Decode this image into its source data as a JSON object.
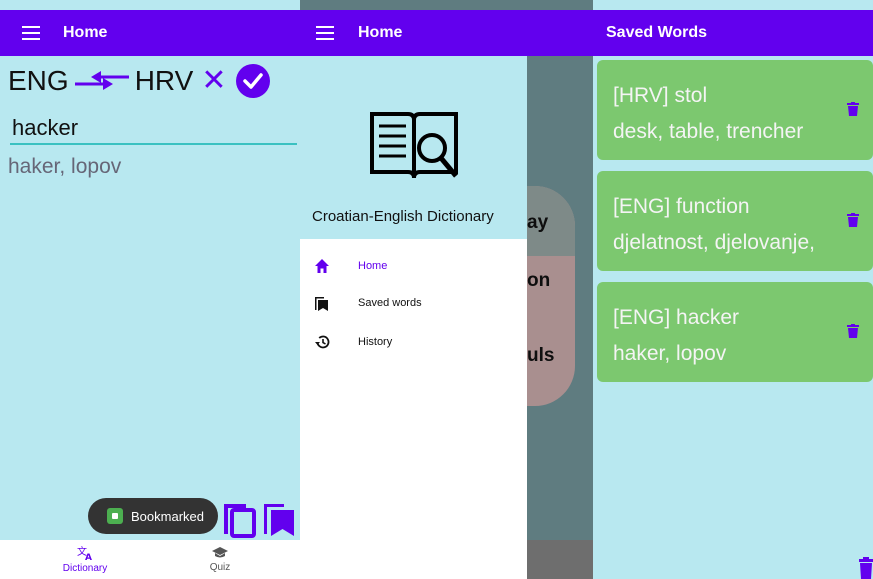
{
  "colors": {
    "primary": "#6200ee",
    "background": "#b8e8f0",
    "card": "#7cc86f",
    "underline": "#3ac1c1"
  },
  "dictionary": {
    "appbar": {
      "title": "Home",
      "menu_icon": "hamburger-menu-icon"
    },
    "source_lang": "ENG",
    "target_lang": "HRV",
    "swap_icon": "swap-arrows-icon",
    "clear_icon": "close-icon",
    "confirm_icon": "check-circle-icon",
    "search": {
      "value": "hacker",
      "placeholder": ""
    },
    "translation": "haker, lopov",
    "toast": {
      "label": "Bookmarked",
      "icon": "app-icon"
    },
    "actions": {
      "copy_icon": "copy-icon",
      "bookmark_icon": "bookmark-icon"
    },
    "bottom_nav": [
      {
        "label": "Dictionary",
        "icon": "translate-icon",
        "active": true
      },
      {
        "label": "Quiz",
        "icon": "graduation-cap-icon",
        "active": false
      }
    ]
  },
  "drawer_screen": {
    "appbar": {
      "title": "Home",
      "menu_icon": "hamburger-menu-icon"
    },
    "drawer": {
      "logo_icon": "dictionary-book-icon",
      "app_name": "Croatian-English Dictionary",
      "items": [
        {
          "label": "Home",
          "icon": "home-icon",
          "active": true
        },
        {
          "label": "Saved words",
          "icon": "bookmark-icon",
          "active": false
        },
        {
          "label": "History",
          "icon": "history-icon",
          "active": false
        }
      ]
    },
    "background_fragments": [
      "ay",
      "on",
      "uls"
    ]
  },
  "saved_words": {
    "appbar": {
      "title": "Saved Words"
    },
    "items": [
      {
        "word": "[HRV] stol",
        "translation": "desk, table, trencher"
      },
      {
        "word": "[ENG] function",
        "translation": "djelatnost, djelovanje,"
      },
      {
        "word": "[ENG] hacker",
        "translation": "haker, lopov"
      }
    ],
    "delete_icon": "trash-icon"
  }
}
